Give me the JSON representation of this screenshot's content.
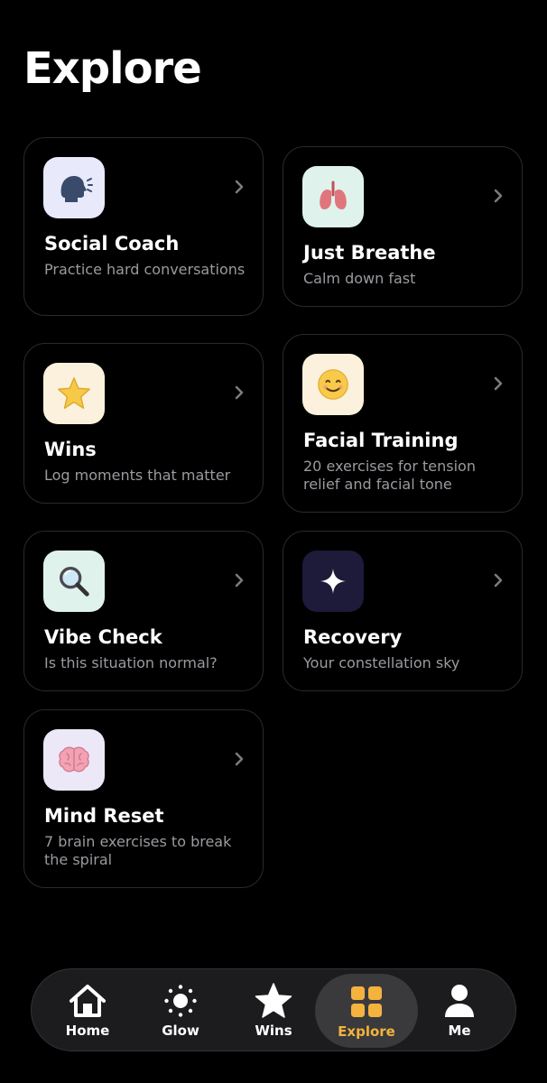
{
  "page": {
    "title": "Explore"
  },
  "cards": [
    {
      "title": "Social Coach",
      "subtitle": "Practice hard conversations",
      "icon": "speaking-head-icon",
      "tile_color": "#e8e9fb"
    },
    {
      "title": "Just Breathe",
      "subtitle": "Calm down fast",
      "icon": "lungs-icon",
      "tile_color": "#dff3ec"
    },
    {
      "title": "Wins",
      "subtitle": "Log moments that matter",
      "icon": "star-icon",
      "tile_color": "#fbf1dc"
    },
    {
      "title": "Facial Training",
      "subtitle": "20 exercises for tension relief and facial tone",
      "icon": "smiling-face-icon",
      "tile_color": "#fbf1dc"
    },
    {
      "title": "Vibe Check",
      "subtitle": "Is this situation normal?",
      "icon": "magnifying-glass-icon",
      "tile_color": "#dff3ec"
    },
    {
      "title": "Recovery",
      "subtitle": "Your constellation sky",
      "icon": "sparkle-icon",
      "tile_color": "#1d1a3a"
    },
    {
      "title": "Mind Reset",
      "subtitle": "7 brain exercises to break the spiral",
      "icon": "brain-icon",
      "tile_color": "#ece8f8"
    }
  ],
  "tabbar": {
    "accent_color": "#f4b23e",
    "tabs": [
      {
        "label": "Home",
        "icon": "home-icon"
      },
      {
        "label": "Glow",
        "icon": "sun-icon"
      },
      {
        "label": "Wins",
        "icon": "star-icon"
      },
      {
        "label": "Explore",
        "icon": "grid-icon",
        "active": true
      },
      {
        "label": "Me",
        "icon": "person-icon"
      }
    ]
  }
}
